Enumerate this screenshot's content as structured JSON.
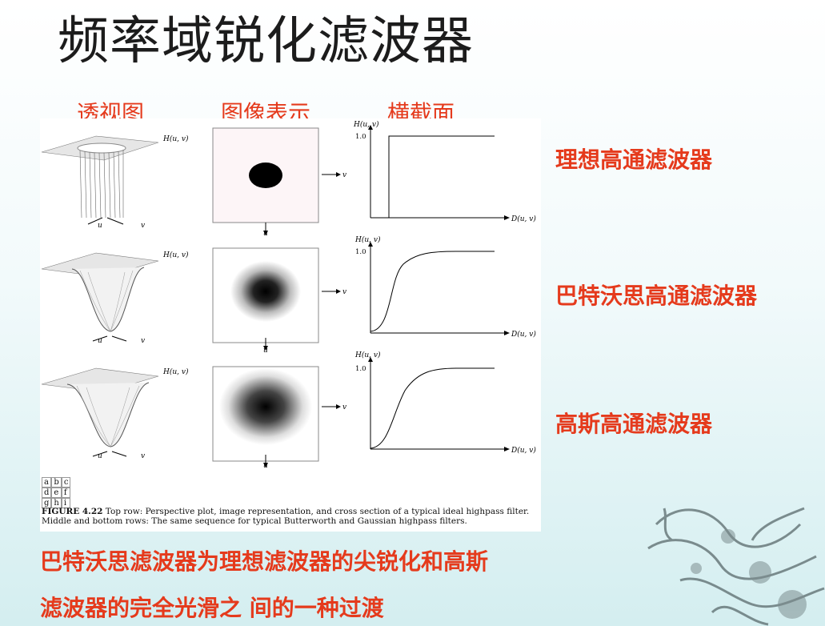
{
  "title": "频率域锐化滤波器",
  "column_headers": [
    "透视图",
    "图像表示",
    "横截面"
  ],
  "filter_labels": [
    "理想高通滤波器",
    "巴特沃思高通滤波器",
    "高斯高通滤波器"
  ],
  "figure": {
    "perspective_axis": "H(u, v)",
    "u": "u",
    "v": "v",
    "cross_y_axis": "H(u, v)",
    "cross_x_axis": "D(u, v)",
    "cross_tick": "1.0",
    "panel_grid": [
      [
        "a",
        "b",
        "c"
      ],
      [
        "d",
        "e",
        "f"
      ],
      [
        "g",
        "h",
        "i"
      ]
    ],
    "caption_bold": "FIGURE 4.22",
    "caption_text": "Top row: Perspective plot, image representation, and cross section of a typical ideal highpass filter. Middle and bottom rows: The same sequence for typical Butterworth and Gaussian highpass filters."
  },
  "summary_lines": [
    "巴特沃思滤波器为理想滤波器的尖锐化和高斯",
    "滤波器的完全光滑之 间的一种过渡"
  ],
  "colors": {
    "accent": "#e53a1c",
    "title": "#1c1c1c"
  }
}
